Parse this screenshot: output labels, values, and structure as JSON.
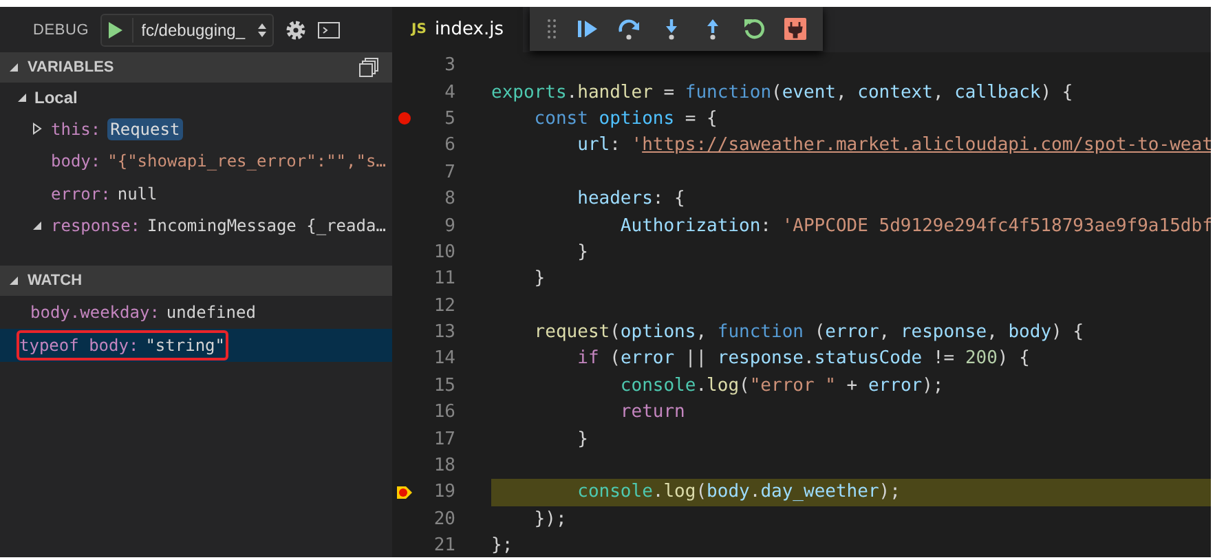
{
  "debug_bar": {
    "label": "DEBUG",
    "configuration": "fc/debugging_"
  },
  "variables": {
    "title": "VARIABLES",
    "expanded": true,
    "scopes": [
      {
        "name": "Local",
        "expanded": true,
        "items": [
          {
            "label": "this:",
            "value": "Request",
            "kind": "object",
            "expandable": true,
            "expanded": false,
            "highlighted": true
          },
          {
            "label": "body:",
            "value": "\"{\"showapi_res_error\":\"\",\"s…",
            "kind": "string",
            "expandable": false,
            "highlighted": false
          },
          {
            "label": "error:",
            "value": "null",
            "kind": "object",
            "expandable": false,
            "highlighted": false
          },
          {
            "label": "response:",
            "value": "IncomingMessage {_reada…",
            "kind": "object",
            "expandable": true,
            "expanded": true,
            "highlighted": false
          }
        ]
      }
    ]
  },
  "watch": {
    "title": "WATCH",
    "expanded": true,
    "items": [
      {
        "label": "body.weekday:",
        "value": "undefined",
        "selected": false,
        "annotated": false
      },
      {
        "label": "typeof body:",
        "value": "\"string\"",
        "selected": true,
        "annotated": true
      }
    ]
  },
  "editor": {
    "tab": {
      "icon_text": "JS",
      "label": "index.js",
      "selected": true
    },
    "toolbar": [
      {
        "kind": "grip"
      },
      {
        "kind": "continue"
      },
      {
        "kind": "step-over"
      },
      {
        "kind": "step-into"
      },
      {
        "kind": "step-out"
      },
      {
        "kind": "restart"
      },
      {
        "kind": "disconnect"
      }
    ],
    "lines": [
      {
        "number": "3",
        "breakpoint": false,
        "current": false
      },
      {
        "number": "4",
        "breakpoint": false,
        "current": false,
        "tokens": [
          {
            "t": "exports",
            "kind": "obj"
          },
          {
            "t": ".",
            "kind": "p"
          },
          {
            "t": "handler",
            "kind": "fn"
          },
          {
            "t": " = ",
            "kind": "p"
          },
          {
            "t": "function",
            "kind": "kw"
          },
          {
            "t": "(",
            "kind": "p"
          },
          {
            "t": "event",
            "kind": "var"
          },
          {
            "t": ", ",
            "kind": "p"
          },
          {
            "t": "context",
            "kind": "var"
          },
          {
            "t": ", ",
            "kind": "p"
          },
          {
            "t": "callback",
            "kind": "var"
          },
          {
            "t": ") {",
            "kind": "p"
          }
        ]
      },
      {
        "number": "5",
        "breakpoint": true,
        "current": false,
        "tokens": [
          {
            "t": "    const",
            "kind": "kw"
          },
          {
            "t": " options",
            "kind": "const"
          },
          {
            "t": " = {",
            "kind": "p"
          }
        ]
      },
      {
        "number": "6",
        "breakpoint": false,
        "current": false,
        "tokens": [
          {
            "t": "        url",
            "kind": "var"
          },
          {
            "t": ": ",
            "kind": "p"
          },
          {
            "t": "'",
            "kind": "str"
          },
          {
            "t": "https://saweather.market.alicloudapi.com/spot-to-weat",
            "kind": "link"
          }
        ]
      },
      {
        "number": "7",
        "breakpoint": false,
        "current": false
      },
      {
        "number": "8",
        "breakpoint": false,
        "current": false,
        "tokens": [
          {
            "t": "        headers",
            "kind": "var"
          },
          {
            "t": ": {",
            "kind": "p"
          }
        ]
      },
      {
        "number": "9",
        "breakpoint": false,
        "current": false,
        "tokens": [
          {
            "t": "            Authorization",
            "kind": "var"
          },
          {
            "t": ": ",
            "kind": "p"
          },
          {
            "t": "'APPCODE 5d9129e294fc4f518793ae9f9a15dbf",
            "kind": "str"
          }
        ]
      },
      {
        "number": "10",
        "breakpoint": false,
        "current": false,
        "tokens": [
          {
            "t": "        }",
            "kind": "p"
          }
        ]
      },
      {
        "number": "11",
        "breakpoint": false,
        "current": false,
        "tokens": [
          {
            "t": "    }",
            "kind": "p"
          }
        ]
      },
      {
        "number": "12",
        "breakpoint": false,
        "current": false
      },
      {
        "number": "13",
        "breakpoint": false,
        "current": false,
        "tokens": [
          {
            "t": "    request",
            "kind": "fn"
          },
          {
            "t": "(",
            "kind": "p"
          },
          {
            "t": "options",
            "kind": "var"
          },
          {
            "t": ", ",
            "kind": "p"
          },
          {
            "t": "function",
            "kind": "kw"
          },
          {
            "t": " (",
            "kind": "p"
          },
          {
            "t": "error",
            "kind": "var"
          },
          {
            "t": ", ",
            "kind": "p"
          },
          {
            "t": "response",
            "kind": "var"
          },
          {
            "t": ", ",
            "kind": "p"
          },
          {
            "t": "body",
            "kind": "var"
          },
          {
            "t": ") {",
            "kind": "p"
          }
        ]
      },
      {
        "number": "14",
        "breakpoint": false,
        "current": false,
        "tokens": [
          {
            "t": "        if",
            "kind": "ctrl"
          },
          {
            "t": " (",
            "kind": "p"
          },
          {
            "t": "error",
            "kind": "var"
          },
          {
            "t": " || ",
            "kind": "p"
          },
          {
            "t": "response",
            "kind": "var"
          },
          {
            "t": ".",
            "kind": "p"
          },
          {
            "t": "statusCode",
            "kind": "var"
          },
          {
            "t": " != ",
            "kind": "p"
          },
          {
            "t": "200",
            "kind": "num"
          },
          {
            "t": ") {",
            "kind": "p"
          }
        ]
      },
      {
        "number": "15",
        "breakpoint": false,
        "current": false,
        "tokens": [
          {
            "t": "            console",
            "kind": "obj"
          },
          {
            "t": ".",
            "kind": "p"
          },
          {
            "t": "log",
            "kind": "fn"
          },
          {
            "t": "(",
            "kind": "p"
          },
          {
            "t": "\"error \"",
            "kind": "str"
          },
          {
            "t": " + ",
            "kind": "p"
          },
          {
            "t": "error",
            "kind": "var"
          },
          {
            "t": ");",
            "kind": "p"
          }
        ]
      },
      {
        "number": "16",
        "breakpoint": false,
        "current": false,
        "tokens": [
          {
            "t": "            return",
            "kind": "ctrl"
          }
        ]
      },
      {
        "number": "17",
        "breakpoint": false,
        "current": false,
        "tokens": [
          {
            "t": "        }",
            "kind": "p"
          }
        ]
      },
      {
        "number": "18",
        "breakpoint": false,
        "current": false
      },
      {
        "number": "19",
        "breakpoint": true,
        "current": true,
        "tokens": [
          {
            "t": "        console",
            "kind": "obj"
          },
          {
            "t": ".",
            "kind": "p"
          },
          {
            "t": "log",
            "kind": "fn"
          },
          {
            "t": "(",
            "kind": "p"
          },
          {
            "t": "body",
            "kind": "var"
          },
          {
            "t": ".",
            "kind": "p"
          },
          {
            "t": "day_weether",
            "kind": "var"
          },
          {
            "t": ");",
            "kind": "p"
          }
        ]
      },
      {
        "number": "20",
        "breakpoint": false,
        "current": false,
        "tokens": [
          {
            "t": "    });",
            "kind": "p"
          }
        ]
      },
      {
        "number": "21",
        "breakpoint": false,
        "current": false,
        "tokens": [
          {
            "t": "};",
            "kind": "p"
          }
        ]
      }
    ]
  }
}
